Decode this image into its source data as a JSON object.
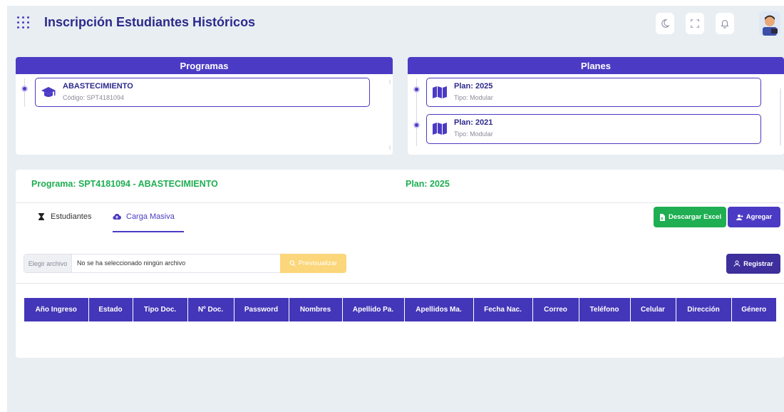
{
  "header": {
    "title": "Inscripción Estudiantes Históricos",
    "icons": [
      "apps-grid-icon",
      "moon-icon",
      "fullscreen-icon",
      "bell-icon",
      "user-avatar"
    ]
  },
  "programas": {
    "title": "Programas",
    "items": [
      {
        "name": "ABASTECIMIENTO",
        "code": "Código: SPT4181094",
        "icon": "graduation-cap-icon"
      }
    ]
  },
  "planes": {
    "title": "Planes",
    "items": [
      {
        "name": "Plan: 2025",
        "type": "Tipo: Modular",
        "icon": "map-icon"
      },
      {
        "name": "Plan: 2021",
        "type": "Tipo: Modular",
        "icon": "map-icon"
      }
    ]
  },
  "main": {
    "programa_label": "Programa: SPT4181094 - ABASTECIMIENTO",
    "plan_label": "Plan: 2025",
    "tabs": [
      {
        "label": "Estudiantes",
        "icon": "hourglass-icon",
        "active": false
      },
      {
        "label": "Carga Masiva",
        "icon": "cloud-upload-icon",
        "active": true
      }
    ],
    "buttons": {
      "descargar_excel": "Descargar Excel",
      "agregar": "Agregar",
      "registrar": "Registrar",
      "previsualizar": "Previsualizar"
    },
    "file_input": {
      "choose_label": "Elegir archivo",
      "status": "No se ha seleccionado ningún archivo"
    },
    "table": {
      "columns": [
        "Año Ingreso",
        "Estado",
        "Tipo Doc.",
        "Nº Doc.",
        "Password",
        "Nombres",
        "Apellido Pa.",
        "Apellidos Ma.",
        "Fecha Nac.",
        "Correo",
        "Teléfono",
        "Celular",
        "Dirección",
        "Género"
      ],
      "rows": []
    }
  },
  "colors": {
    "primary": "#4b3bc4",
    "success": "#1fae52",
    "warning": "#fbd67a",
    "background": "#e9eef2"
  }
}
